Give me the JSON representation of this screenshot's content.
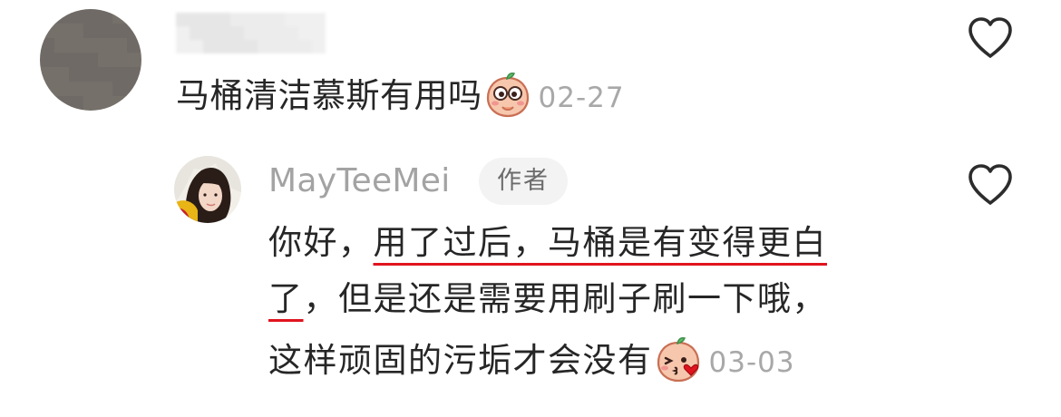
{
  "comment": {
    "username_hidden": true,
    "text": "马桶清洁慕斯有用吗",
    "emoji_icon": "peach-smile-emoji-icon",
    "date": "02-27",
    "like_icon": "heart-outline-icon"
  },
  "reply": {
    "author": "MayTeeMei",
    "author_tag": "作者",
    "lines": [
      {
        "plain_before": "你好，",
        "underlined": "用了过后，马桶是有变得更白",
        "plain_after": ""
      },
      {
        "plain_before": "",
        "underlined": "了",
        "plain_after": "，但是还是需要用刷子刷一下哦，"
      },
      {
        "plain_before": "这样顽固的污垢才会没有",
        "underlined": "",
        "plain_after": ""
      }
    ],
    "emoji_icon": "peach-kiss-emoji-icon",
    "date": "03-03",
    "like_icon": "heart-outline-icon"
  },
  "colors": {
    "text": "#262626",
    "meta": "#a8a8a8",
    "underline": "#e0141e",
    "tag_bg": "#f3f3f3"
  }
}
